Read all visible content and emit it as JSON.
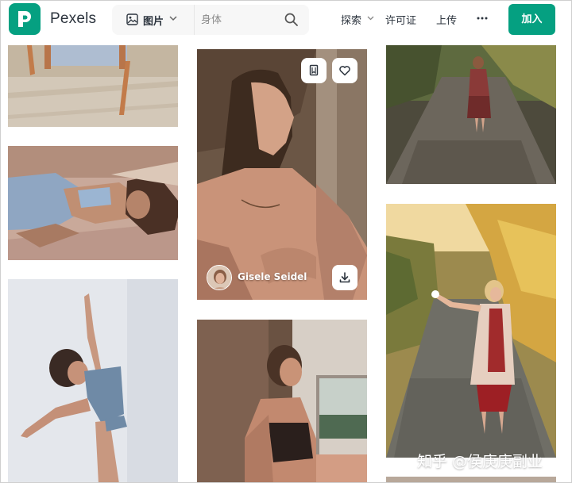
{
  "header": {
    "brand": "Pexels",
    "search": {
      "type_label": "图片",
      "placeholder": "身体"
    },
    "nav": {
      "explore": "探索",
      "license": "许可证",
      "upload": "上传",
      "more": "···"
    },
    "join_label": "加入"
  },
  "featured_photo": {
    "author": "Gisele Seidel"
  },
  "watermark": "知乎 @侯庚庚副业",
  "colors": {
    "brand_green": "#05a081",
    "text": "#2c343e"
  },
  "icons": [
    "pexels-logo-icon",
    "image-icon",
    "chevron-down-icon",
    "search-icon",
    "more-icon",
    "collect-icon",
    "heart-icon",
    "download-icon"
  ]
}
